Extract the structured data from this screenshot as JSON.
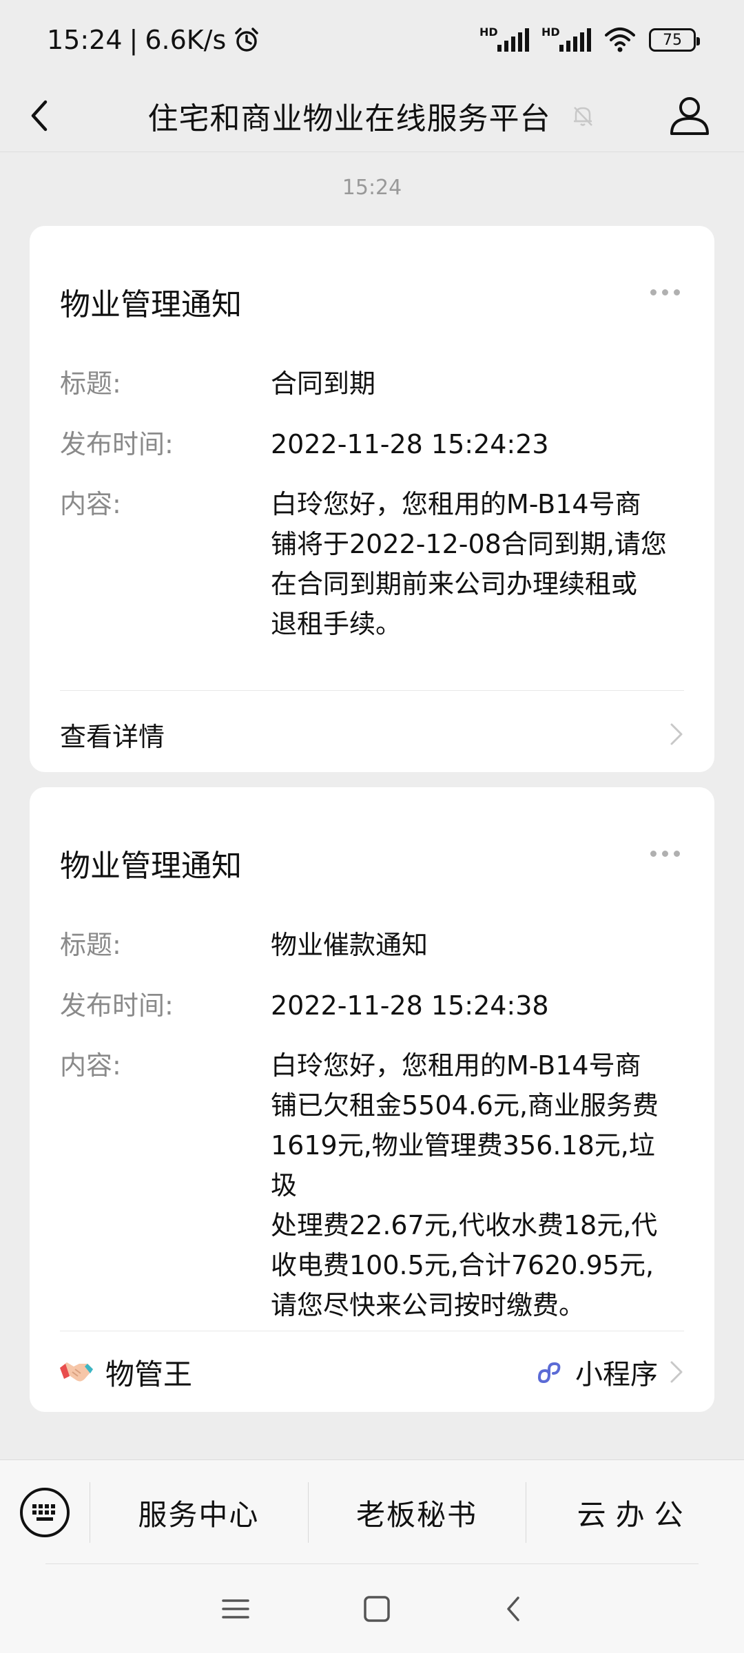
{
  "status": {
    "time": "15:24",
    "speed": "6.6K/s",
    "battery": "75",
    "hd": "HD"
  },
  "header": {
    "title": "住宅和商业物业在线服务平台"
  },
  "chat": {
    "timestamp": "15:24"
  },
  "cards": [
    {
      "title": "物业管理通知",
      "title_label": "标题:",
      "title_value": "合同到期",
      "time_label": "发布时间:",
      "time_value": "2022-11-28 15:24:23",
      "content_label": "内容:",
      "content_lines": [
        "白玲您好，您租用的M-B14号商",
        "铺将于2022-12-08合同到期,请您",
        "在合同到期前来公司办理续租或",
        "退租手续。"
      ],
      "detail_label": "查看详情"
    },
    {
      "title": "物业管理通知",
      "title_label": "标题:",
      "title_value": "物业催款通知",
      "time_label": "发布时间:",
      "time_value": "2022-11-28 15:24:38",
      "content_label": "内容:",
      "content_lines": [
        "白玲您好，您租用的M-B14号商",
        "铺已欠租金5504.6元,商业服务费",
        "1619元,物业管理费356.18元,垃圾",
        "处理费22.67元,代收水费18元,代",
        "收电费100.5元,合计7620.95元,",
        "请您尽快来公司按时缴费。"
      ],
      "mini_app_name": "物管王",
      "mini_app_type": "小程序"
    }
  ],
  "menu": {
    "items": [
      "服务中心",
      "老板秘书",
      "云办公"
    ]
  },
  "colors": {
    "background": "#ededed",
    "card": "#ffffff",
    "label": "#8a8a8a",
    "mini_program_icon": "#5b6bd6"
  }
}
